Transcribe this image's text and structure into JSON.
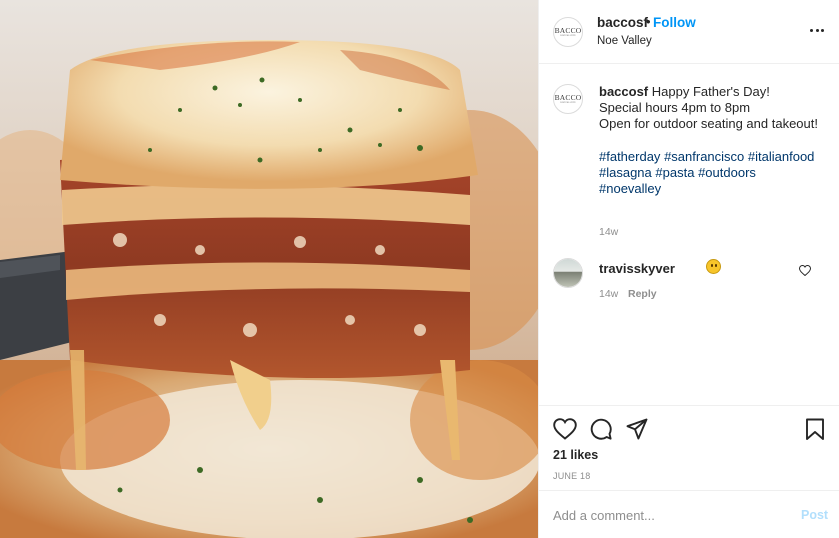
{
  "post": {
    "image_subject": "lasagna-slice-photo",
    "username": "baccosf",
    "location": "Noe Valley",
    "follow_label": "Follow",
    "separator": "•",
    "avatar_logo_text": "BACCO",
    "avatar_logo_subtext": "RISTORANTE"
  },
  "caption": {
    "username": "baccosf",
    "lines": [
      "Happy Father's Day!",
      "Special hours 4pm to 8pm",
      "Open for outdoor seating and takeout!"
    ],
    "hashtags": [
      "#fatherday",
      "#sanfrancisco",
      "#italianfood",
      "#lasagna",
      "#pasta",
      "#outdoors",
      "#noevalley"
    ],
    "time": "14w"
  },
  "comment": {
    "username": "travisskyver",
    "emoji": "smiling-face-emoji",
    "time": "14w",
    "reply_label": "Reply"
  },
  "actions": {
    "likes": "21 likes",
    "date": "JUNE 18",
    "icons": [
      "heart-icon",
      "comment-icon",
      "share-icon",
      "save-icon"
    ]
  },
  "add_comment": {
    "placeholder": "Add a comment...",
    "post_label": "Post"
  },
  "colors": {
    "link_blue": "#0095f6",
    "hashtag_blue": "#00376b",
    "muted_gray": "#8e8e8e",
    "post_disabled": "#b2dffc",
    "divider": "#efefef"
  }
}
